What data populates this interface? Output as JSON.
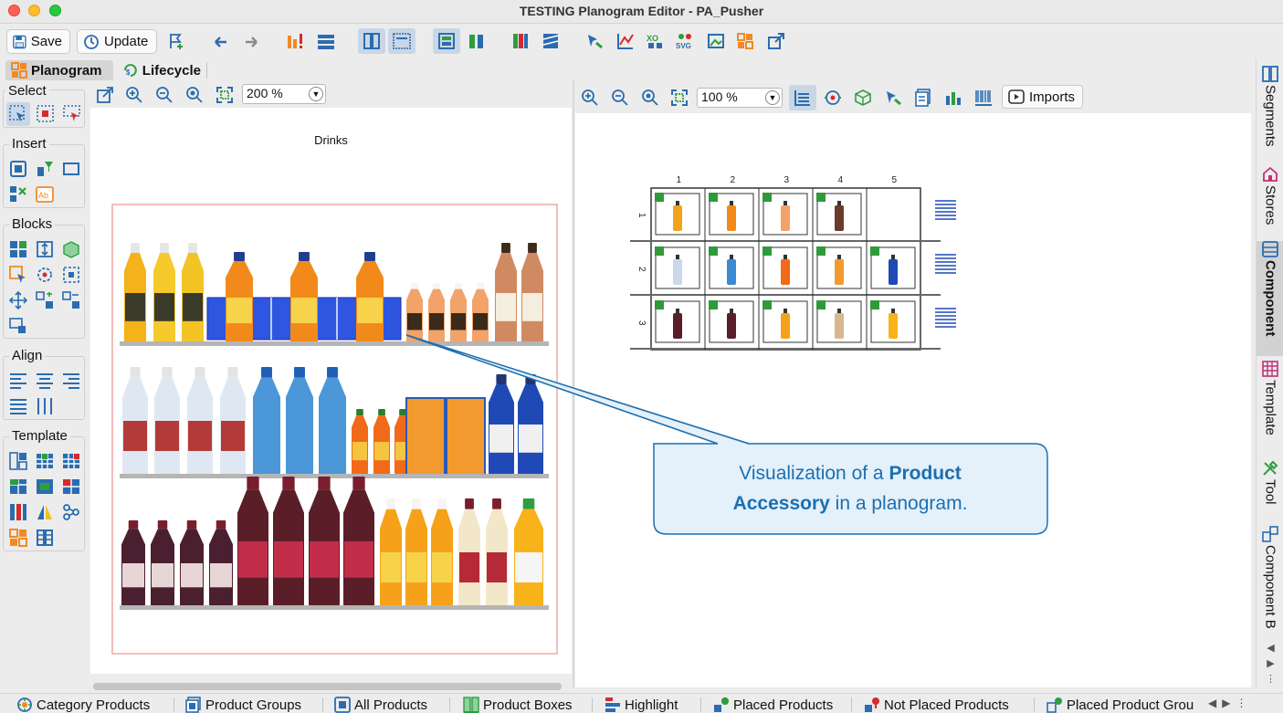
{
  "window": {
    "title": "TESTING Planogram Editor - PA_Pusher"
  },
  "toolbar": {
    "save_label": "Save",
    "update_label": "Update"
  },
  "perspectives": [
    {
      "label": "Planogram",
      "active": true
    },
    {
      "label": "Lifecycle",
      "active": false
    }
  ],
  "palette": {
    "select_title": "Select",
    "insert_title": "Insert",
    "blocks_title": "Blocks",
    "align_title": "Align",
    "template_title": "Template"
  },
  "left_editor": {
    "zoom": "200 %",
    "fixture_label": "Drinks"
  },
  "right_editor": {
    "zoom": "100 %",
    "imports_label": "Imports",
    "column_numbers": [
      "1",
      "2",
      "3",
      "4",
      "5"
    ],
    "row_numbers": [
      "1",
      "2",
      "3"
    ]
  },
  "side_tabs": [
    {
      "label": "Segments",
      "icon": "segments-icon",
      "active": false
    },
    {
      "label": "Stores",
      "icon": "store-icon",
      "active": false
    },
    {
      "label": "Component",
      "icon": "component-icon",
      "active": true
    },
    {
      "label": "Template",
      "icon": "template-grid-icon",
      "active": false
    },
    {
      "label": "Tool",
      "icon": "tool-icon",
      "active": false
    },
    {
      "label": "Component B",
      "icon": "component-b-icon",
      "active": false
    }
  ],
  "bottom_tabs": [
    {
      "label": "Category Products",
      "icon": "category-icon"
    },
    {
      "label": "Product Groups",
      "icon": "product-group-icon"
    },
    {
      "label": "All Products",
      "icon": "product-icon"
    },
    {
      "label": "Product Boxes",
      "icon": "product-box-icon"
    },
    {
      "label": "Highlight",
      "icon": "highlight-icon"
    },
    {
      "label": "Placed Products",
      "icon": "placed-products-icon"
    },
    {
      "label": "Not Placed Products",
      "icon": "not-placed-icon"
    },
    {
      "label": "Placed Product Grou",
      "icon": "placed-group-icon"
    }
  ],
  "callout": {
    "text_1": "Visualization of a ",
    "bold_1": "Product",
    "bold_2": "Accessory",
    "text_2": " in a planogram."
  },
  "colors": {
    "accent_blue": "#1c6fb0",
    "callout_fill": "#e4f0fa",
    "shelf_gray": "#b5b5b5",
    "fixture_outline": "#f0a7a7",
    "marker_green": "#2f9a3a",
    "accessory_blue": "#2f56e0"
  }
}
